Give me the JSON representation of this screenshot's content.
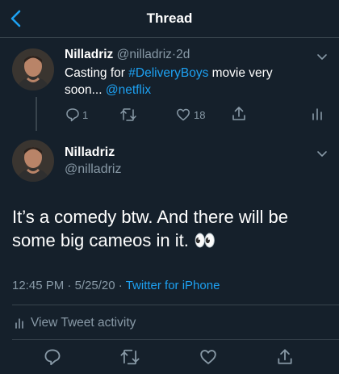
{
  "header": {
    "title": "Thread",
    "back_icon": "chevron-left-icon"
  },
  "colors": {
    "background": "#15202b",
    "accent": "#1da1f2",
    "muted": "#8899a6",
    "divider": "#38444d"
  },
  "tweet1": {
    "name": "Nilladriz",
    "handle": "@nilladriz",
    "separator": "·",
    "time": "2d",
    "text_prefix": "Casting for ",
    "hashtag": "#DeliveryBoys",
    "text_middle": " movie very soon... ",
    "mention": "@netflix",
    "actions": {
      "reply_count": "1",
      "retweet_count": "",
      "like_count": "18"
    }
  },
  "tweet2": {
    "name": "Nilladriz",
    "handle": "@nilladriz",
    "text": "It’s a comedy btw. And there will be some big cameos in it. 👀",
    "time": "12:45 PM",
    "separator1": "·",
    "date": "5/25/20",
    "separator2": "·",
    "source": "Twitter for iPhone",
    "activity_label": "View Tweet activity"
  }
}
